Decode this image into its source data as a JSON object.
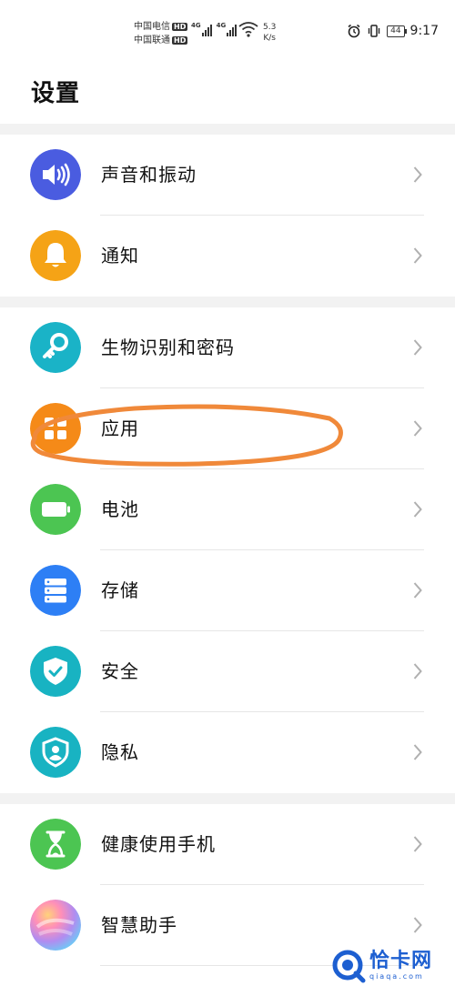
{
  "status_bar": {
    "carrier_1": "中国电信",
    "carrier_2": "中国联通",
    "hd_badge": "HD",
    "network_1": "4G",
    "network_2": "4G",
    "speed_value": "5.3",
    "speed_unit": "K/s",
    "battery_level": "44",
    "time": "9:17"
  },
  "header": {
    "title": "设置"
  },
  "groups": [
    {
      "items": [
        {
          "label": "声音和振动",
          "icon": "speaker-icon",
          "color": "#4a5ce0"
        },
        {
          "label": "通知",
          "icon": "bell-icon",
          "color": "#f5a316"
        }
      ]
    },
    {
      "items": [
        {
          "label": "生物识别和密码",
          "icon": "key-icon",
          "color": "#1ab3c7"
        },
        {
          "label": "应用",
          "icon": "apps-grid-icon",
          "color": "#f58a18"
        },
        {
          "label": "电池",
          "icon": "battery-icon",
          "color": "#4cc552"
        },
        {
          "label": "存储",
          "icon": "storage-icon",
          "color": "#2d7ff5"
        },
        {
          "label": "安全",
          "icon": "shield-check-icon",
          "color": "#18b3c2"
        },
        {
          "label": "隐私",
          "icon": "privacy-shield-icon",
          "color": "#18b3c2"
        }
      ]
    },
    {
      "items": [
        {
          "label": "健康使用手机",
          "icon": "hourglass-icon",
          "color": "#4cc552"
        },
        {
          "label": "智慧助手",
          "icon": "assistant-icon",
          "color": "#c58ae8"
        }
      ]
    }
  ],
  "annotation": {
    "color": "#f0893a"
  },
  "watermark": {
    "name": "恰卡网",
    "url": "qiaqa.com"
  }
}
